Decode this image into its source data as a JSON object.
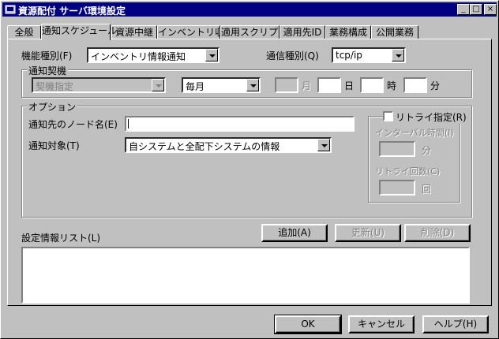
{
  "window": {
    "title": "資源配付 サーバ環境設定",
    "controls": {
      "minimize": "_",
      "maximize": "□",
      "close": "×"
    }
  },
  "tabs": [
    {
      "label": "全般"
    },
    {
      "label": "通知スケジュール",
      "active": true
    },
    {
      "label": "資源中継"
    },
    {
      "label": "インベントリ収集"
    },
    {
      "label": "適用スクリプト"
    },
    {
      "label": "適用先ID"
    },
    {
      "label": "業務構成"
    },
    {
      "label": "公開業務"
    }
  ],
  "form": {
    "function_type_label": "機能種別(F)",
    "function_type_value": "インベントリ情報通知",
    "comm_type_label": "通信種別(Q)",
    "comm_type_value": "tcp/ip"
  },
  "trigger": {
    "group_title": "通知契機",
    "trigger_value": "契機指定",
    "period_value": "毎月",
    "month_label": "月",
    "day_label": "日",
    "hour_label": "時",
    "minute_label": "分"
  },
  "options": {
    "group_title": "オプション",
    "node_name_label": "通知先のノード名(E)",
    "node_name_value": "",
    "target_label": "通知対象(T)",
    "target_value": "自システムと全配下システムの情報",
    "retry": {
      "label": "リトライ指定(R)",
      "checked": false,
      "interval_label": "インターバル時間(I)",
      "interval_unit": "分",
      "count_label": "リトライ回数(C)",
      "count_unit": "回"
    }
  },
  "list": {
    "label": "設定情報リスト(L)",
    "add_button": "追加(A)",
    "update_button": "更新(U)",
    "delete_button": "削除(D)"
  },
  "footer": {
    "ok_button": "OK",
    "cancel_button": "キャンセル",
    "help_button": "ヘルプ(H)"
  }
}
